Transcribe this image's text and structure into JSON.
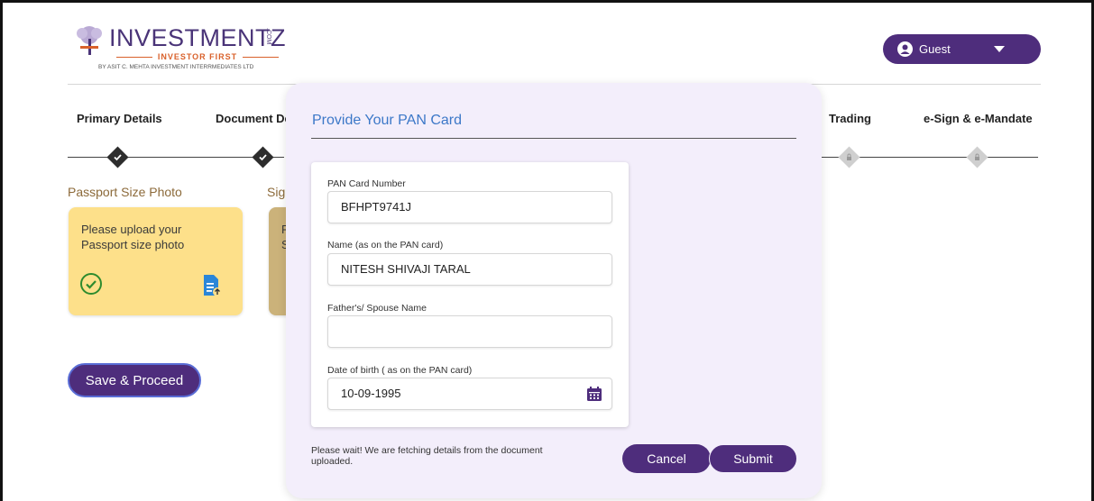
{
  "header": {
    "logo_word": "INVESTMENTZ",
    "logo_com": ".COM",
    "logo_tagline": "INVESTOR FIRST",
    "logo_sub": "BY ASIT C. MEHTA INVESTMENT INTERRMEDIATES LTD",
    "user_label": "Guest"
  },
  "steps": [
    {
      "label": "Primary Details",
      "state": "done"
    },
    {
      "label": "Document De",
      "state": "done"
    },
    {
      "label": "Trading",
      "state": "locked"
    },
    {
      "label": "e-Sign & e-Mandate",
      "state": "locked"
    }
  ],
  "documents": {
    "passport_label": "Passport Size Photo",
    "passport_text": "Please upload your Passport size photo",
    "signature_label": "Sig",
    "signature_text": "P S"
  },
  "save_label": "Save & Proceed",
  "modal": {
    "title": "Provide Your PAN Card",
    "fields": {
      "pan_label": "PAN Card Number",
      "pan_value": "BFHPT9741J",
      "name_label": "Name (as on the PAN card)",
      "name_value": "NITESH SHIVAJI TARAL",
      "father_label": "Father's/ Spouse Name",
      "father_value": "",
      "dob_label": "Date of birth ( as on the PAN card)",
      "dob_value": "10-09-1995"
    },
    "wait_text": "Please wait! We are fetching details from the document uploaded.",
    "cancel_label": "Cancel",
    "submit_label": "Submit"
  },
  "colors": {
    "brand_purple": "#4e2d7c",
    "card_yellow": "#fde08a",
    "modal_bg": "#f3eefb",
    "title_blue": "#3c78c8",
    "check_green": "#2e8b2e"
  }
}
